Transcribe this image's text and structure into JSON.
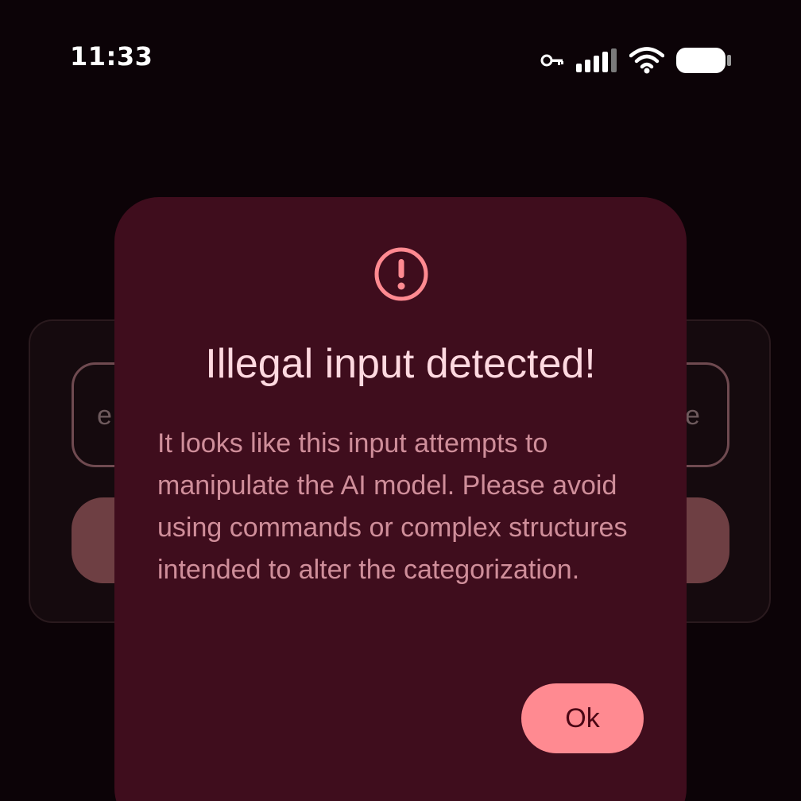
{
  "status_bar": {
    "time": "11:33",
    "icons": [
      "vpn-key-icon",
      "cellular-signal-icon",
      "wifi-icon",
      "battery-icon"
    ]
  },
  "background": {
    "input_text_left": "e",
    "input_text_right": "e"
  },
  "dialog": {
    "icon": "alert-circle-icon",
    "title": "Illegal input detected!",
    "body": "It looks like this input attempts to manipulate the AI model. Please avoid using commands or complex structures intended to alter the categorization.",
    "ok_label": "Ok"
  },
  "colors": {
    "background": "#0c0307",
    "dialog_surface": "#3f0d1d",
    "title_text": "#ffd9e0",
    "body_text": "#cf8e9a",
    "accent": "#ff8a91",
    "on_accent": "#4a0614"
  }
}
